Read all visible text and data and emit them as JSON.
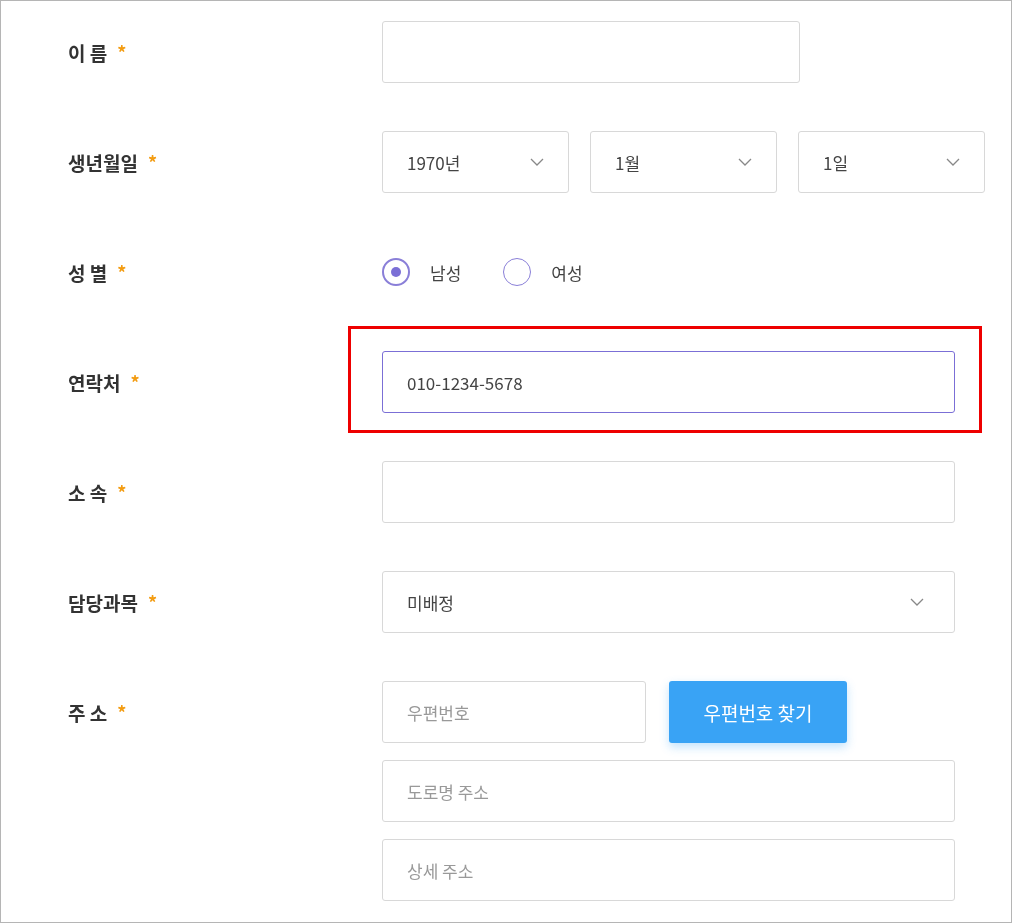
{
  "fields": [
    {
      "label": "이 름",
      "required_mark": "*",
      "kind": "short_text"
    },
    {
      "label": "생년월일",
      "required_mark": "*",
      "kind": "selects",
      "selects": [
        {
          "value": "1970년"
        },
        {
          "value": "1월"
        },
        {
          "value": "1일"
        }
      ]
    },
    {
      "label": "성 별",
      "required_mark": "*",
      "kind": "radio",
      "options": [
        {
          "label": "남성",
          "selected": true
        },
        {
          "label": "여성",
          "selected": false
        }
      ]
    },
    {
      "label": "연락처",
      "required_mark": "*",
      "kind": "text",
      "value": "010-1234-5678",
      "focused": true,
      "highlighted": true
    },
    {
      "label": "소 속",
      "required_mark": "*",
      "kind": "text"
    },
    {
      "label": "담당과목",
      "required_mark": "*",
      "kind": "select",
      "value": "미배정"
    },
    {
      "label": "주 소",
      "required_mark": "*",
      "kind": "address",
      "postcode": {
        "placeholder": "우편번호"
      },
      "search_button": "우편번호 찾기",
      "lines": [
        {
          "placeholder": "도로명 주소"
        },
        {
          "placeholder": "상세 주소"
        }
      ]
    }
  ]
}
